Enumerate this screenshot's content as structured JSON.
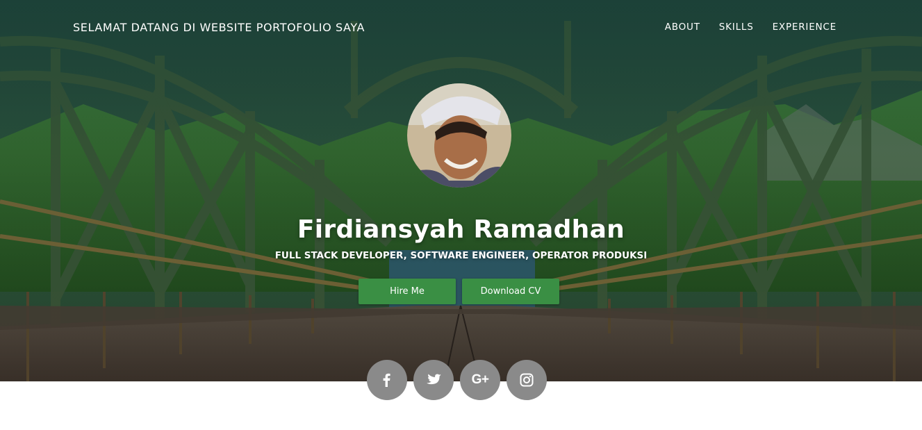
{
  "nav": {
    "brand": "SELAMAT DATANG DI WEBSITE PORTOFOLIO SAYA",
    "items": [
      {
        "label": "ABOUT"
      },
      {
        "label": "SKILLS"
      },
      {
        "label": "EXPERIENCE"
      }
    ]
  },
  "hero": {
    "name": "Firdiansyah Ramadhan",
    "subtitle": "FULL STACK DEVELOPER, SOFTWARE ENGINEER, OPERATOR PRODUKSI",
    "hire_label": "Hire Me",
    "cv_label": "Download CV"
  },
  "social": {
    "icons": [
      "facebook-icon",
      "twitter-icon",
      "google-plus-icon",
      "instagram-icon"
    ],
    "gplus_glyph": "G+"
  },
  "colors": {
    "button": "#3a8f44",
    "social_bg": "#8a8a8a",
    "text": "#ffffff"
  }
}
